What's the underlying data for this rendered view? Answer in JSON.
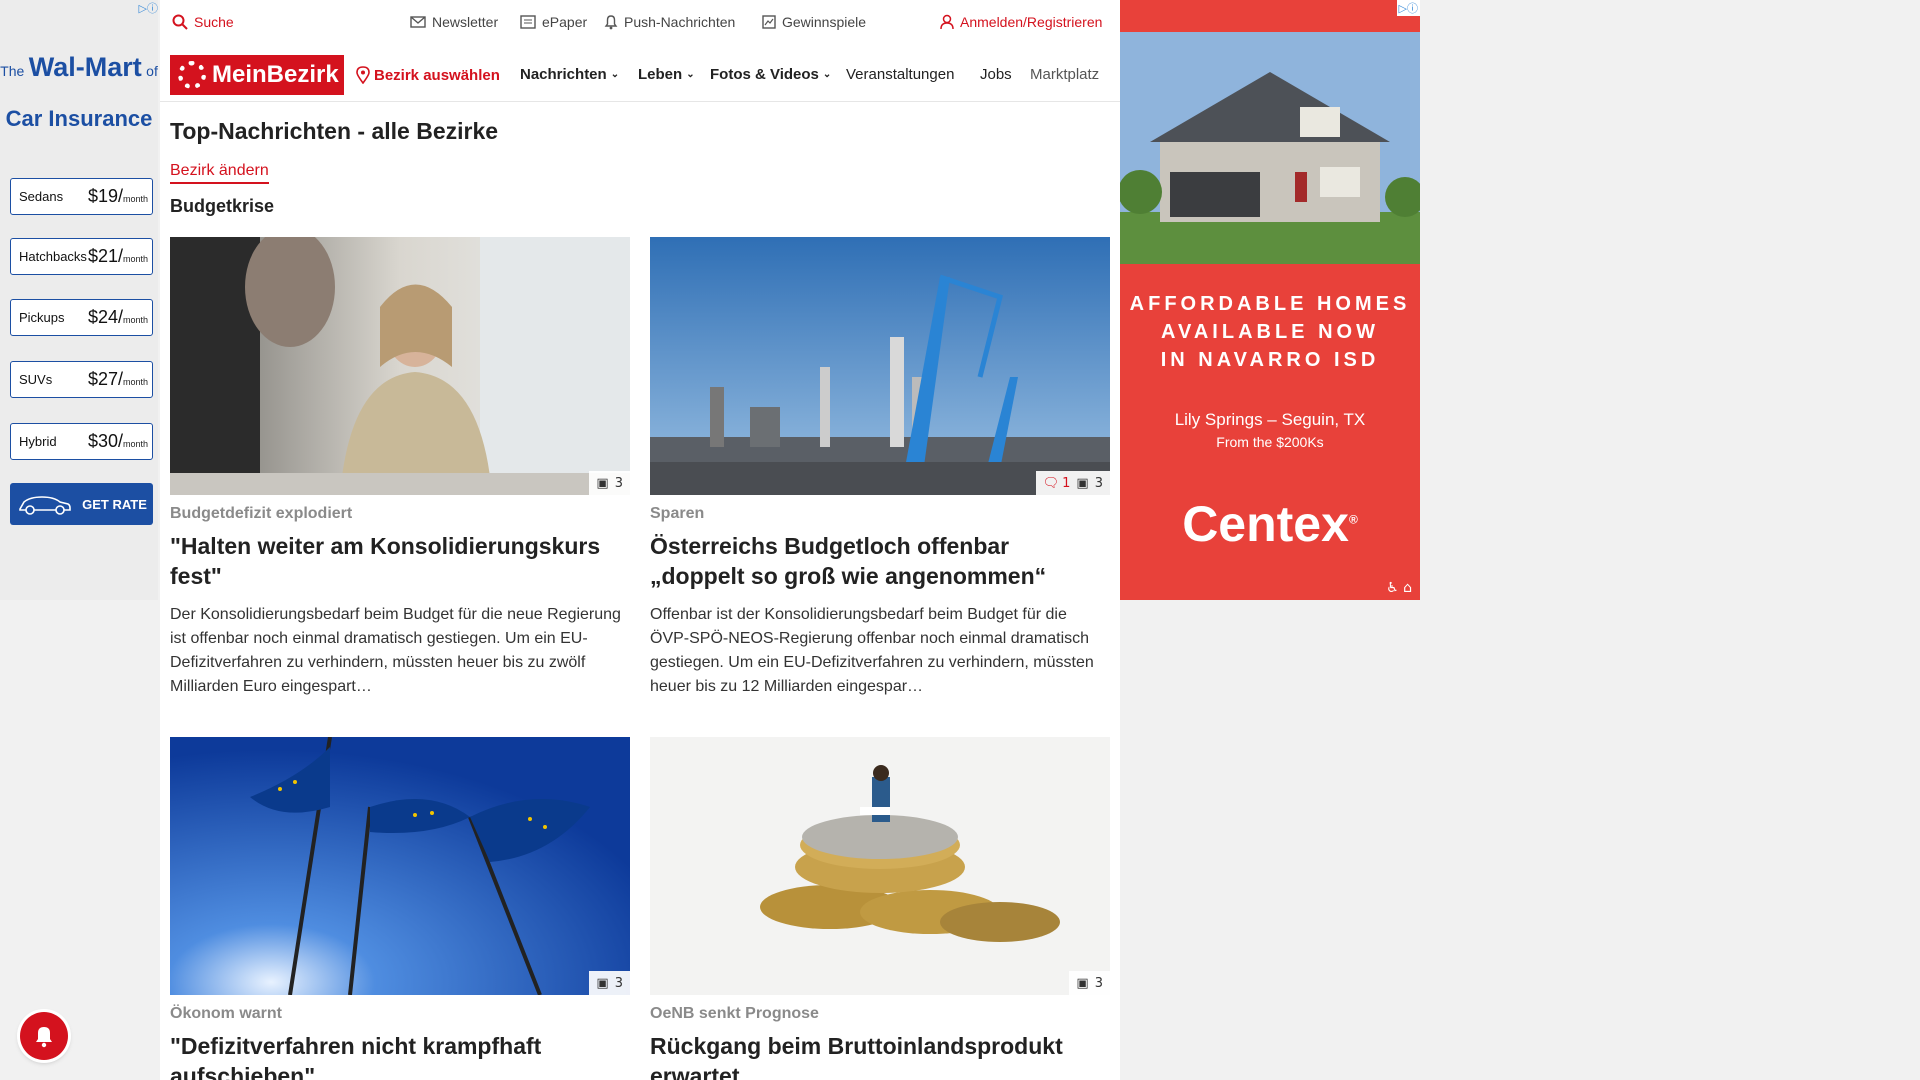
{
  "left_ad": {
    "the": "The",
    "brand": "Wal-Mart",
    "of": "of",
    "subtitle": "Car Insurance",
    "rows": [
      {
        "name": "Sedans",
        "price": "$19/",
        "per": "month"
      },
      {
        "name": "Hatchbacks",
        "price": "$21/",
        "per": "month"
      },
      {
        "name": "Pickups",
        "price": "$24/",
        "per": "month"
      },
      {
        "name": "SUVs",
        "price": "$27/",
        "per": "month"
      },
      {
        "name": "Hybrid",
        "price": "$30/",
        "per": "month"
      }
    ],
    "cta": "GET RATE"
  },
  "topbar": {
    "search": "Suche",
    "newsletter": "Newsletter",
    "epaper": "ePaper",
    "push": "Push-Nachrichten",
    "gewinnspiele": "Gewinnspiele",
    "login": "Anmelden/Registrieren"
  },
  "nav": {
    "logo": "MeinBezirk",
    "bezirk": "Bezirk auswählen",
    "items": [
      "Nachrichten",
      "Leben",
      "Fotos & Videos",
      "Veranstaltungen",
      "Jobs",
      "Marktplatz"
    ]
  },
  "page": {
    "title": "Top-Nachrichten - alle Bezirke",
    "change_link": "Bezirk ändern",
    "section": "Budgetkrise"
  },
  "articles": [
    {
      "kicker": "Budgetdefizit explodiert",
      "headline": "\"Halten weiter am Konsolidierungskurs fest\"",
      "teaser": "Der Konsolidierungsbedarf beim Budget für die neue Regierung ist offenbar noch einmal dramatisch gestiegen. Um ein EU-Defizitverfahren zu verhindern, müssten heuer bis zu zwölf Milliarden Euro eingespart…",
      "photos": "3",
      "comments": ""
    },
    {
      "kicker": "Sparen",
      "headline": "Österreichs Budgetloch offenbar „doppelt so groß wie angenommen“",
      "teaser": "Offenbar ist der Konsolidierungsbedarf beim Budget für die ÖVP-SPÖ-NEOS-Regierung offenbar noch einmal dramatisch gestiegen. Um ein EU-Defizitverfahren zu verhindern, müssten heuer bis zu 12 Milliarden eingespar…",
      "photos": "3",
      "comments": "1"
    },
    {
      "kicker": "Ökonom warnt",
      "headline": "\"Defizitverfahren nicht krampfhaft aufschieben\"",
      "teaser": "",
      "photos": "3",
      "comments": ""
    },
    {
      "kicker": "OeNB senkt Prognose",
      "headline": "Rückgang beim Bruttoinlandsprodukt erwartet",
      "teaser": "",
      "photos": "3",
      "comments": ""
    }
  ],
  "right_ad": {
    "headline_1": "AFFORDABLE HOMES",
    "headline_2": "AVAILABLE NOW",
    "headline_3": "IN NAVARRO ISD",
    "location": "Lily Springs – Seguin, TX",
    "price": "From the $200Ks",
    "brand": "Centex",
    "registered": "®"
  },
  "colors": {
    "brand_red": "#d4121e",
    "ad_red": "#e8413a",
    "ad_blue": "#1c4fa3"
  }
}
